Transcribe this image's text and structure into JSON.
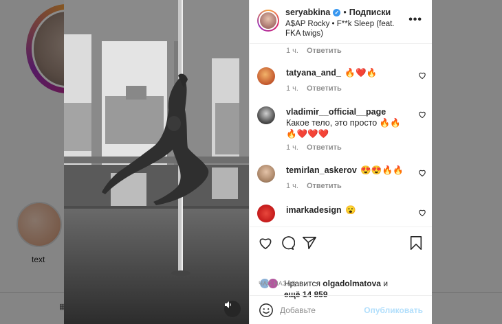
{
  "background": {
    "highlight_label": "text"
  },
  "post": {
    "username": "seryabkina",
    "separator": "•",
    "follow_status": "Подписки",
    "song": "A$AP Rocky • F**k Sleep (feat. FKA twigs)"
  },
  "first_meta": {
    "time": "1 ч.",
    "reply": "Ответить"
  },
  "comments": [
    {
      "user": "tatyana_and_",
      "text": "🔥❤️🔥",
      "time": "1 ч.",
      "reply": "Ответить"
    },
    {
      "user": "vladimir__official__page",
      "text": "Какое тело, это просто 🔥🔥🔥❤️❤️❤️",
      "time": "1 ч.",
      "reply": "Ответить"
    },
    {
      "user": "temirlan_askerov",
      "text": "😍😍🔥🔥",
      "time": "1 ч.",
      "reply": "Ответить"
    },
    {
      "user": "imarkadesign",
      "text": "😮"
    }
  ],
  "likes": {
    "prefix": "Нравится",
    "user": "olgadolmatova",
    "conj": "и",
    "more": "ещё 14 859"
  },
  "time_ago": "ЧАС НАЗАД",
  "add_comment": {
    "placeholder": "Добавьте",
    "publish": "Опубликовать"
  },
  "colors": {
    "accent": "#3897f0",
    "publish_disabled": "#b2dffc",
    "muted": "#8e8e8e",
    "text": "#262626"
  }
}
